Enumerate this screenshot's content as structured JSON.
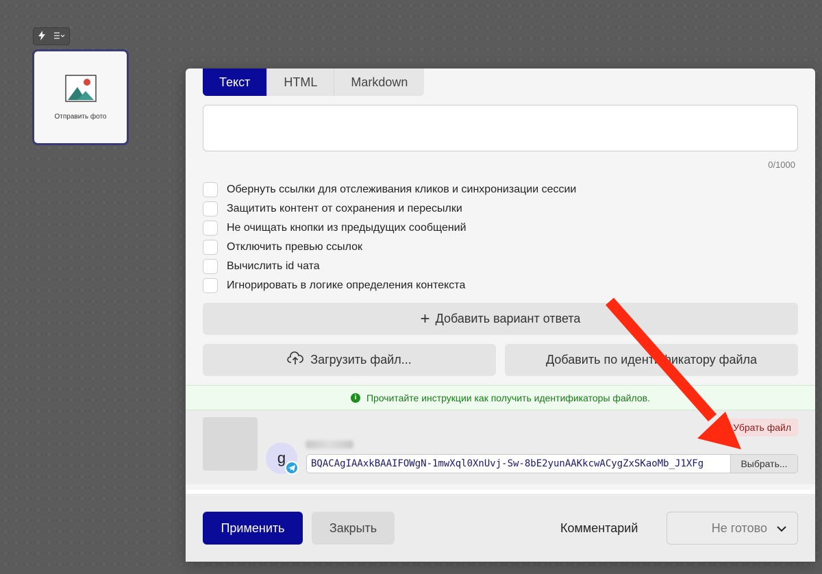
{
  "canvas": {
    "node": {
      "label": "Отправить фото",
      "toolbar_icons": [
        "bolt-icon",
        "list-menu-icon"
      ]
    }
  },
  "modal": {
    "tabs": [
      {
        "label": "Текст",
        "active": true
      },
      {
        "label": "HTML",
        "active": false
      },
      {
        "label": "Markdown",
        "active": false
      }
    ],
    "text_input": {
      "value": "",
      "counter": "0/1000"
    },
    "checkboxes": [
      {
        "label": "Обернуть ссылки для отслеживания кликов и синхронизации сессии",
        "checked": false
      },
      {
        "label": "Защитить контент от сохранения и пересылки",
        "checked": false
      },
      {
        "label": "Не очищать кнопки из предыдущих сообщений",
        "checked": false
      },
      {
        "label": "Отключить превью ссылок",
        "checked": false
      },
      {
        "label": "Вычислить id чата",
        "checked": false
      },
      {
        "label": "Игнорировать в логике определения контекста",
        "checked": false
      }
    ],
    "add_answer_label": "Добавить вариант ответа",
    "upload_file_label": "Загрузить файл...",
    "add_by_id_label": "Добавить по идентификатору файла",
    "info_text": "Прочитайте инструкции как получить идентификаторы файлов.",
    "file": {
      "remove_label": "Убрать файл",
      "avatar_letter": "g",
      "file_id": "BQACAgIAAxkBAAIFOWgN-1mwXql0XnUvj-Sw-8bE2yunAAKkcwACygZxSKaoMb_J1XFg",
      "choose_label": "Выбрать..."
    },
    "footer": {
      "apply_label": "Применить",
      "close_label": "Закрыть",
      "comment_label": "Комментарий",
      "status_value": "Не готово"
    }
  },
  "colors": {
    "primary": "#0b0b9a",
    "info_green": "#1b7a1b",
    "danger": "#8a1a1a",
    "annotation_arrow": "#ff2a10"
  }
}
